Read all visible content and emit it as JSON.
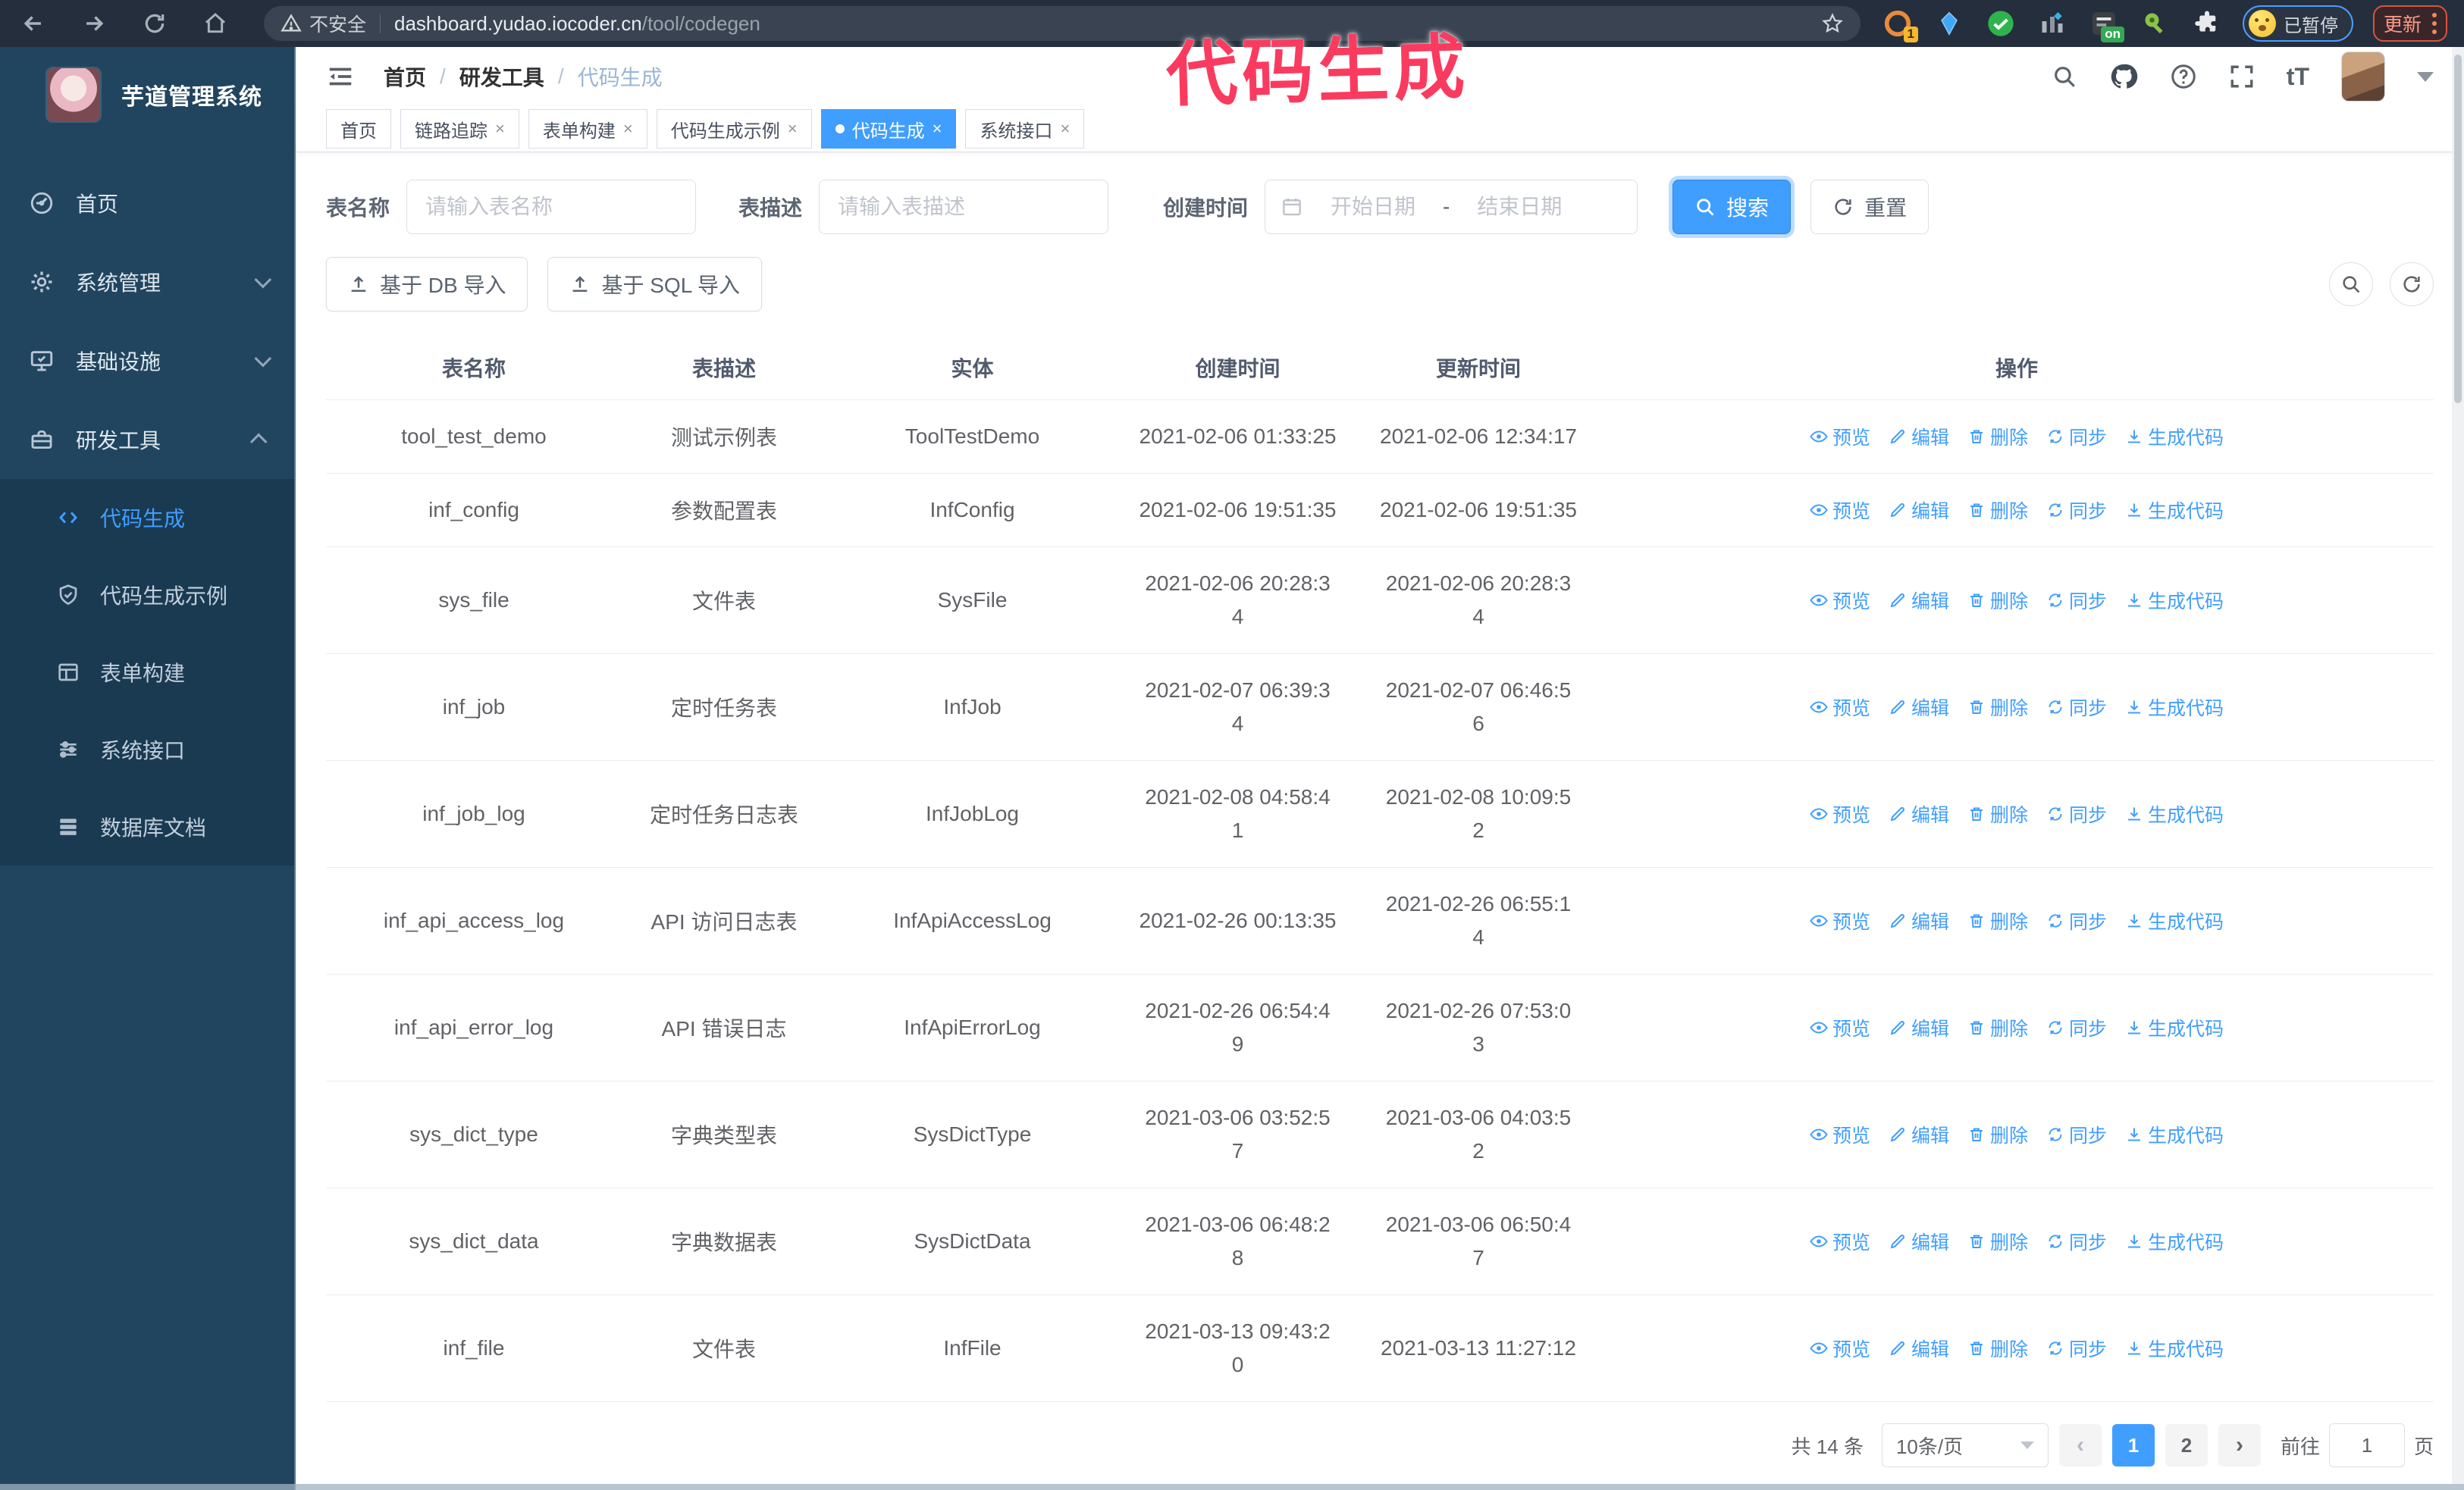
{
  "colors": {
    "accent": "#409eff",
    "sidebar_bg": "#21455f",
    "annotation": "#fa3b5f",
    "active_tab_bg": "#409eff"
  },
  "browser": {
    "insecure_label": "不安全",
    "url_host": "dashboard.yudao.iocoder.cn",
    "url_path": "/tool/codegen",
    "extension_badge_1": "1",
    "extension_badge_on": "on",
    "paused_badge": "已暂停",
    "update_button": "更新"
  },
  "annotation": {
    "text": "代码生成"
  },
  "sidebar": {
    "title": "芋道管理系统",
    "items": [
      {
        "label": "首页"
      },
      {
        "label": "系统管理"
      },
      {
        "label": "基础设施"
      },
      {
        "label": "研发工具"
      }
    ],
    "sub_items": [
      {
        "label": "代码生成"
      },
      {
        "label": "代码生成示例"
      },
      {
        "label": "表单构建"
      },
      {
        "label": "系统接口"
      },
      {
        "label": "数据库文档"
      }
    ]
  },
  "header": {
    "breadcrumb": [
      "首页",
      "研发工具",
      "代码生成"
    ]
  },
  "tabs": [
    {
      "label": "首页"
    },
    {
      "label": "链路追踪"
    },
    {
      "label": "表单构建"
    },
    {
      "label": "代码生成示例"
    },
    {
      "label": "代码生成"
    },
    {
      "label": "系统接口"
    }
  ],
  "filters": {
    "table_name_label": "表名称",
    "table_name_placeholder": "请输入表名称",
    "table_desc_label": "表描述",
    "table_desc_placeholder": "请输入表描述",
    "create_time_label": "创建时间",
    "start_placeholder": "开始日期",
    "range_separator": "-",
    "end_placeholder": "结束日期",
    "search_label": "搜索",
    "reset_label": "重置"
  },
  "toolbar": {
    "import_db_label": "基于 DB 导入",
    "import_sql_label": "基于 SQL 导入"
  },
  "table": {
    "columns": [
      "表名称",
      "表描述",
      "实体",
      "创建时间",
      "更新时间",
      "操作"
    ],
    "actions": [
      {
        "label": "预览"
      },
      {
        "label": "编辑"
      },
      {
        "label": "删除"
      },
      {
        "label": "同步"
      },
      {
        "label": "生成代码"
      }
    ],
    "rows": [
      {
        "name": "tool_test_demo",
        "desc": "测试示例表",
        "entity": "ToolTestDemo",
        "create_time": "2021-02-06 01:33:25",
        "update_time": "2021-02-06 12:34:17"
      },
      {
        "name": "inf_config",
        "desc": "参数配置表",
        "entity": "InfConfig",
        "create_time": "2021-02-06 19:51:35",
        "update_time": "2021-02-06 19:51:35"
      },
      {
        "name": "sys_file",
        "desc": "文件表",
        "entity": "SysFile",
        "create_time": "2021-02-06 20:28:3\n4",
        "update_time": "2021-02-06 20:28:3\n4"
      },
      {
        "name": "inf_job",
        "desc": "定时任务表",
        "entity": "InfJob",
        "create_time": "2021-02-07 06:39:3\n4",
        "update_time": "2021-02-07 06:46:5\n6"
      },
      {
        "name": "inf_job_log",
        "desc": "定时任务日志表",
        "entity": "InfJobLog",
        "create_time": "2021-02-08 04:58:4\n1",
        "update_time": "2021-02-08 10:09:5\n2"
      },
      {
        "name": "inf_api_access_log",
        "desc": "API 访问日志表",
        "entity": "InfApiAccessLog",
        "create_time": "2021-02-26 00:13:35",
        "update_time": "2021-02-26 06:55:1\n4"
      },
      {
        "name": "inf_api_error_log",
        "desc": "API 错误日志",
        "entity": "InfApiErrorLog",
        "create_time": "2021-02-26 06:54:4\n9",
        "update_time": "2021-02-26 07:53:0\n3"
      },
      {
        "name": "sys_dict_type",
        "desc": "字典类型表",
        "entity": "SysDictType",
        "create_time": "2021-03-06 03:52:5\n7",
        "update_time": "2021-03-06 04:03:5\n2"
      },
      {
        "name": "sys_dict_data",
        "desc": "字典数据表",
        "entity": "SysDictData",
        "create_time": "2021-03-06 06:48:2\n8",
        "update_time": "2021-03-06 06:50:4\n7"
      },
      {
        "name": "inf_file",
        "desc": "文件表",
        "entity": "InfFile",
        "create_time": "2021-03-13 09:43:2\n0",
        "update_time": "2021-03-13 11:27:12"
      }
    ]
  },
  "pagination": {
    "total_label": "共 14 条",
    "page_size": "10条/页",
    "prev": "‹",
    "next": "›",
    "pages": [
      "1",
      "2"
    ],
    "goto_label": "前往",
    "goto_value": "1",
    "page_unit": "页"
  }
}
